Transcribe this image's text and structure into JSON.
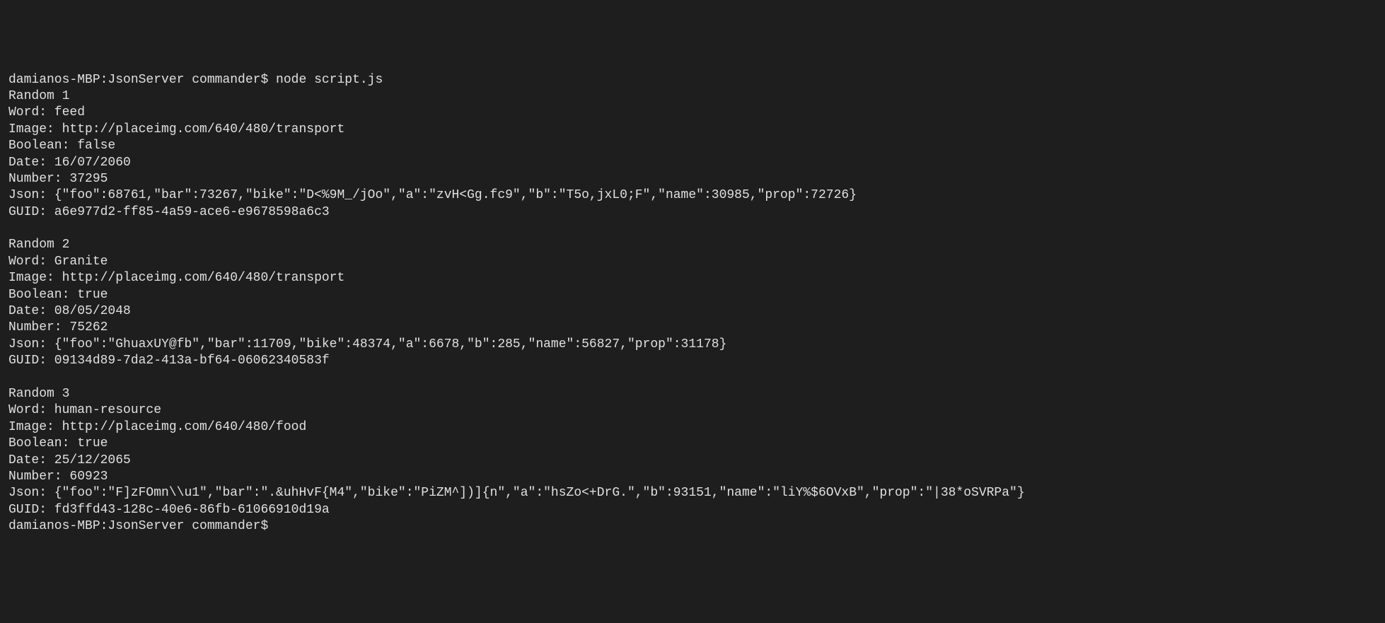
{
  "terminal": {
    "prompt_line": "damianos-MBP:JsonServer commander$ node script.js",
    "blocks": [
      {
        "header": "Random 1",
        "word": "Word: feed",
        "image": "Image: http://placeimg.com/640/480/transport",
        "boolean": "Boolean: false",
        "date": "Date: 16/07/2060",
        "number": "Number: 37295",
        "json": "Json: {\"foo\":68761,\"bar\":73267,\"bike\":\"D<%9M_/jOo\",\"a\":\"zvH<Gg.fc9\",\"b\":\"T5o,jxL0;F\",\"name\":30985,\"prop\":72726}",
        "guid": "GUID: a6e977d2-ff85-4a59-ace6-e9678598a6c3"
      },
      {
        "header": "Random 2",
        "word": "Word: Granite",
        "image": "Image: http://placeimg.com/640/480/transport",
        "boolean": "Boolean: true",
        "date": "Date: 08/05/2048",
        "number": "Number: 75262",
        "json": "Json: {\"foo\":\"GhuaxUY@fb\",\"bar\":11709,\"bike\":48374,\"a\":6678,\"b\":285,\"name\":56827,\"prop\":31178}",
        "guid": "GUID: 09134d89-7da2-413a-bf64-06062340583f"
      },
      {
        "header": "Random 3",
        "word": "Word: human-resource",
        "image": "Image: http://placeimg.com/640/480/food",
        "boolean": "Boolean: true",
        "date": "Date: 25/12/2065",
        "number": "Number: 60923",
        "json": "Json: {\"foo\":\"F]zFOmn\\\\u1\",\"bar\":\".&uhHvF{M4\",\"bike\":\"PiZM^])]{n\",\"a\":\"hsZo<+DrG.\",\"b\":93151,\"name\":\"liY%$6OVxB\",\"prop\":\"|38*oSVRPa\"}",
        "guid": "GUID: fd3ffd43-128c-40e6-86fb-61066910d19a"
      }
    ],
    "trailing_prompt": "damianos-MBP:JsonServer commander$"
  }
}
